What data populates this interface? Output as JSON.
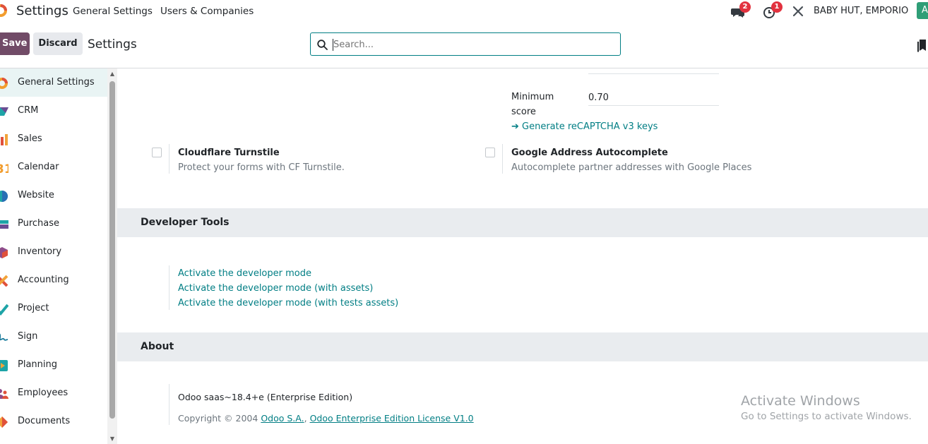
{
  "navbar": {
    "app_title": "Settings",
    "links": [
      "General Settings",
      "Users & Companies"
    ],
    "messages_badge": "2",
    "activities_badge": "1",
    "company": "BABY HUT, EMPORIO",
    "avatar_letter": "A"
  },
  "control_panel": {
    "save_label": "Save",
    "discard_label": "Discard",
    "breadcrumb": "Settings",
    "search_placeholder": "Search..."
  },
  "sidebar": {
    "items": [
      {
        "label": "General Settings",
        "icon": "odoo-logo-icon",
        "active": true
      },
      {
        "label": "CRM",
        "icon": "crm-icon"
      },
      {
        "label": "Sales",
        "icon": "sales-icon"
      },
      {
        "label": "Calendar",
        "icon": "calendar-icon"
      },
      {
        "label": "Website",
        "icon": "website-icon"
      },
      {
        "label": "Purchase",
        "icon": "purchase-icon"
      },
      {
        "label": "Inventory",
        "icon": "inventory-icon"
      },
      {
        "label": "Accounting",
        "icon": "accounting-icon"
      },
      {
        "label": "Project",
        "icon": "project-icon"
      },
      {
        "label": "Sign",
        "icon": "sign-icon"
      },
      {
        "label": "Planning",
        "icon": "planning-icon"
      },
      {
        "label": "Employees",
        "icon": "employees-icon"
      },
      {
        "label": "Documents",
        "icon": "documents-icon"
      }
    ]
  },
  "recaptcha": {
    "min_score_label_line1": "Minimum",
    "min_score_label_line2": "score",
    "min_score_value": "0.70",
    "generate_keys_link": "➔ Generate reCAPTCHA v3 keys"
  },
  "settings": [
    {
      "title": "Cloudflare Turnstile",
      "description": "Protect your forms with CF Turnstile.",
      "checked": false
    },
    {
      "title": "Google Address Autocomplete",
      "description": "Autocomplete partner addresses with Google Places",
      "checked": false
    }
  ],
  "developer_tools": {
    "heading": "Developer Tools",
    "links": [
      "Activate the developer mode",
      "Activate the developer mode (with assets)",
      "Activate the developer mode (with tests assets)"
    ]
  },
  "about": {
    "heading": "About",
    "version": "Odoo saas~18.4+e (Enterprise Edition)",
    "copyright_prefix": "Copyright © 2004",
    "company_link": "Odoo S.A.",
    "license_link": "Odoo Enterprise Edition License V1.0"
  },
  "watermark": {
    "title": "Activate Windows",
    "subtitle": "Go to Settings to activate Windows."
  },
  "colors": {
    "brand": "#714b67",
    "accent": "#017e84",
    "badge": "#e2323f"
  }
}
